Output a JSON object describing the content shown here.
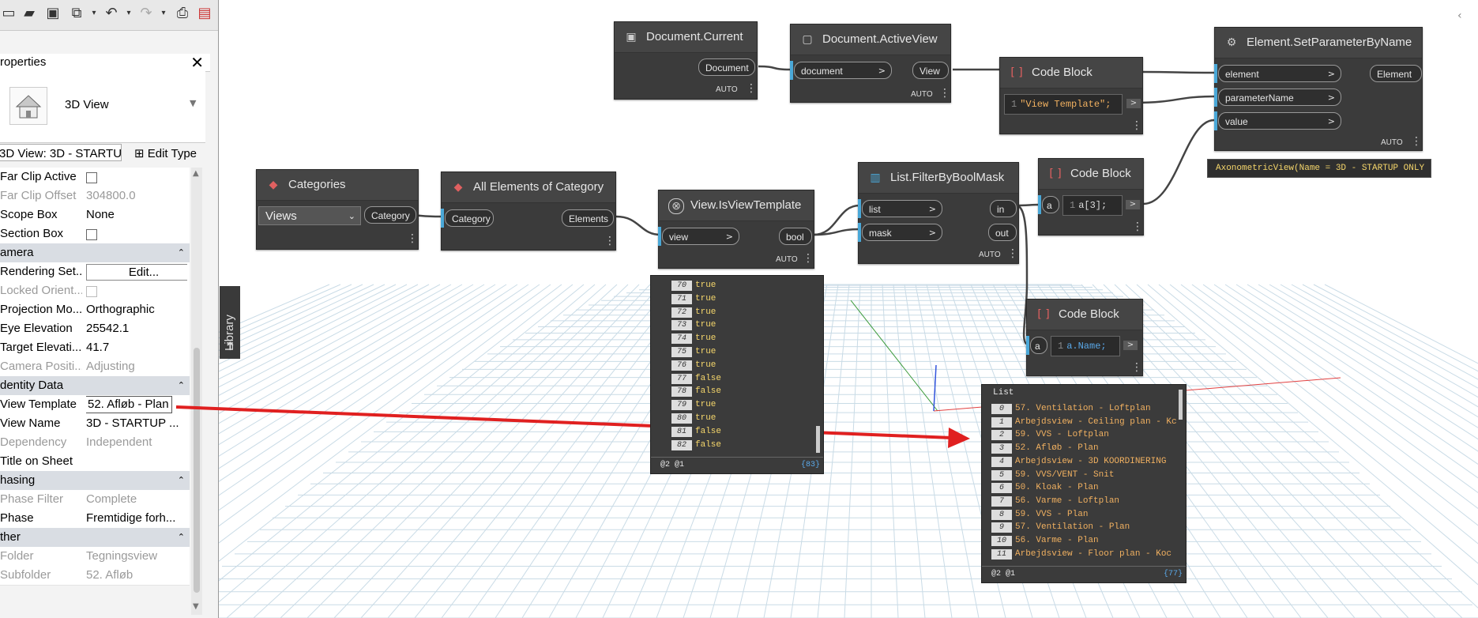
{
  "properties_panel": {
    "title": "roperties",
    "type_name": "3D View",
    "instance_selector": "3D View: 3D - STARTU",
    "edit_type_label": "Edit Type",
    "rows": [
      {
        "kind": "prop",
        "key": "Far Clip Active",
        "value": "",
        "checkbox": true,
        "disabled": false
      },
      {
        "kind": "prop",
        "key": "Far Clip Offset",
        "value": "304800.0",
        "disabled": true
      },
      {
        "kind": "prop",
        "key": "Scope Box",
        "value": "None",
        "disabled": false
      },
      {
        "kind": "prop",
        "key": "Section Box",
        "value": "",
        "checkbox": true,
        "disabled": false
      },
      {
        "kind": "group",
        "key": "amera"
      },
      {
        "kind": "prop",
        "key": "Rendering Set...",
        "value": "Edit...",
        "button": true,
        "disabled": false
      },
      {
        "kind": "prop",
        "key": "Locked Orient...",
        "value": "",
        "checkbox": true,
        "disabled": true
      },
      {
        "kind": "prop",
        "key": "Projection Mo...",
        "value": "Orthographic",
        "disabled": false
      },
      {
        "kind": "prop",
        "key": "Eye Elevation",
        "value": "25542.1",
        "disabled": false
      },
      {
        "kind": "prop",
        "key": "Target Elevati...",
        "value": "41.7",
        "disabled": false
      },
      {
        "kind": "prop",
        "key": "Camera Positi...",
        "value": "Adjusting",
        "disabled": true
      },
      {
        "kind": "group",
        "key": "dentity Data"
      },
      {
        "kind": "prop",
        "key": "View Template",
        "value": "52. Afløb - Plan",
        "selected": true,
        "disabled": false
      },
      {
        "kind": "prop",
        "key": "View Name",
        "value": "3D - STARTUP ...",
        "disabled": false
      },
      {
        "kind": "prop",
        "key": "Dependency",
        "value": "Independent",
        "disabled": true
      },
      {
        "kind": "prop",
        "key": "Title on Sheet",
        "value": "",
        "disabled": false
      },
      {
        "kind": "group",
        "key": "hasing"
      },
      {
        "kind": "prop",
        "key": "Phase Filter",
        "value": "Complete",
        "disabled": true
      },
      {
        "kind": "prop",
        "key": "Phase",
        "value": "Fremtidige forh...",
        "disabled": false
      },
      {
        "kind": "group",
        "key": "ther"
      },
      {
        "kind": "prop",
        "key": "Folder",
        "value": "Tegningsview",
        "disabled": true
      },
      {
        "kind": "prop",
        "key": "Subfolder",
        "value": "52. Afløb",
        "disabled": true
      }
    ]
  },
  "library_label": "Library",
  "nodes": {
    "document_current": {
      "title": "Document.Current",
      "out": "Document",
      "auto": "AUTO"
    },
    "document_activeview": {
      "title": "Document.ActiveView",
      "in": "document",
      "out": "View",
      "auto": "AUTO"
    },
    "code_block_1": {
      "title": "Code Block",
      "line": "1",
      "code": "\"View Template\";"
    },
    "set_param": {
      "title": "Element.SetParameterByName",
      "in1": "element",
      "in2": "parameterName",
      "in3": "value",
      "out": "Element",
      "auto": "AUTO"
    },
    "set_param_tooltip": "AxonometricView(Name = 3D - STARTUP ONLY",
    "categories": {
      "title": "Categories",
      "value": "Views",
      "out": "Category"
    },
    "all_elements": {
      "title": "All Elements of Category",
      "in": "Category",
      "out": "Elements"
    },
    "is_view_template": {
      "title": "View.IsViewTemplate",
      "in": "view",
      "out": "bool",
      "auto": "AUTO"
    },
    "filter_bool_mask": {
      "title": "List.FilterByBoolMask",
      "in1": "list",
      "in2": "mask",
      "out1": "in",
      "out2": "out",
      "auto": "AUTO"
    },
    "code_block_2": {
      "title": "Code Block",
      "port": "a",
      "line": "1",
      "code": "a[3];"
    },
    "code_block_3": {
      "title": "Code Block",
      "port": "a",
      "line": "1",
      "code": "a.Name;"
    }
  },
  "bool_watch": {
    "items": [
      {
        "i": "70",
        "v": "true"
      },
      {
        "i": "71",
        "v": "true"
      },
      {
        "i": "72",
        "v": "true"
      },
      {
        "i": "73",
        "v": "true"
      },
      {
        "i": "74",
        "v": "true"
      },
      {
        "i": "75",
        "v": "true"
      },
      {
        "i": "76",
        "v": "true"
      },
      {
        "i": "77",
        "v": "false"
      },
      {
        "i": "78",
        "v": "false"
      },
      {
        "i": "79",
        "v": "true"
      },
      {
        "i": "80",
        "v": "true"
      },
      {
        "i": "81",
        "v": "false"
      },
      {
        "i": "82",
        "v": "false"
      }
    ],
    "footer_left": "@2 @1",
    "footer_right": "{83}"
  },
  "name_watch": {
    "header": "List",
    "items": [
      {
        "i": "0",
        "v": "57. Ventilation - Loftplan"
      },
      {
        "i": "1",
        "v": "Arbejdsview - Ceiling plan - Kc"
      },
      {
        "i": "2",
        "v": "59. VVS - Loftplan"
      },
      {
        "i": "3",
        "v": "52. Afløb - Plan"
      },
      {
        "i": "4",
        "v": "Arbejdsview - 3D KOORDINERING"
      },
      {
        "i": "5",
        "v": "59. VVS/VENT - Snit"
      },
      {
        "i": "6",
        "v": "50. Kloak - Plan"
      },
      {
        "i": "7",
        "v": "56. Varme - Loftplan"
      },
      {
        "i": "8",
        "v": "59. VVS - Plan"
      },
      {
        "i": "9",
        "v": "57. Ventilation - Plan"
      },
      {
        "i": "10",
        "v": "56. Varme - Plan"
      },
      {
        "i": "11",
        "v": "Arbejdsview - Floor plan - Koc"
      }
    ],
    "footer_left": "@2 @1",
    "footer_right": "{77}"
  },
  "colors": {
    "node_bg": "#3b3b3b",
    "port_accent": "#4aa8d8",
    "arrow": "#e02020",
    "true_text": "#f5d66b",
    "string_text": "#f0b060"
  }
}
